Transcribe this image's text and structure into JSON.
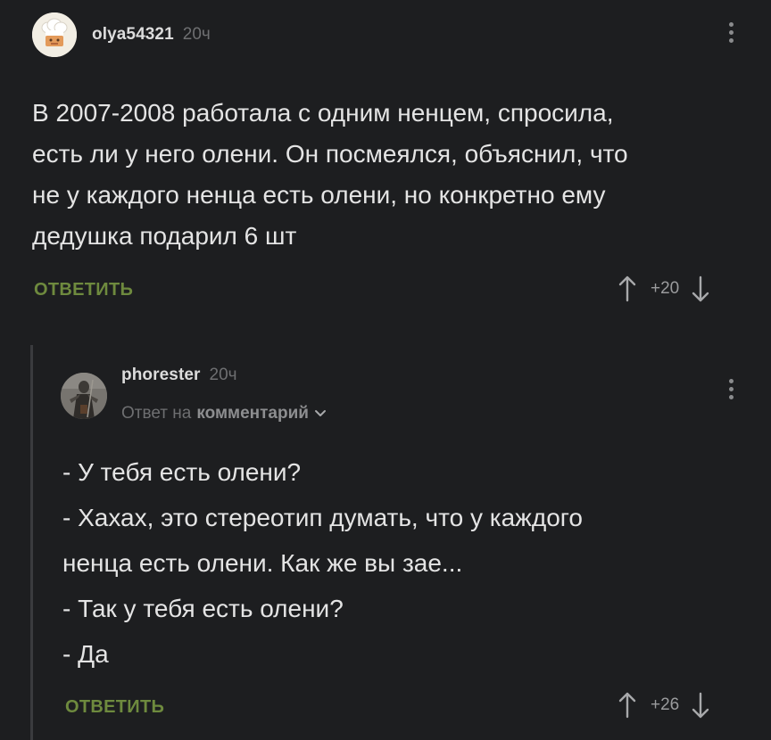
{
  "comments": [
    {
      "author": "olya54321",
      "time": "20ч",
      "text": "В 2007-2008 работала с одним ненцем, спросила,\nесть ли у него олени. Он посмеялся, объяснил, что\nне у каждого ненца есть олени, но конкретно ему\nдедушка подарил 6 шт",
      "reply_label": "ОТВЕТИТЬ",
      "rating": "+20"
    },
    {
      "author": "phorester",
      "time": "20ч",
      "reply_to_prefix": "Ответ на",
      "reply_to_target": "комментарий",
      "text": "- У тебя есть олени?\n- Хахах, это стереотип думать, что у каждого\nненца есть олени. Как же вы зае...\n- Так у тебя есть олени?\n- Да",
      "reply_label": "ОТВЕТИТЬ",
      "rating": "+26"
    }
  ],
  "colors": {
    "background": "#1d1e20",
    "accent_green": "#6e8a3e",
    "muted_text": "#6e6f71"
  }
}
